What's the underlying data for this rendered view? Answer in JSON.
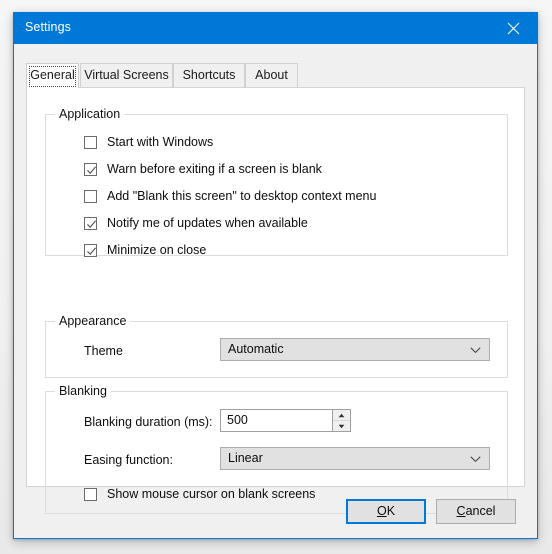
{
  "window": {
    "title": "Settings",
    "close_icon": "close-icon"
  },
  "tabs": [
    {
      "label": "General",
      "selected": true
    },
    {
      "label": "Virtual Screens",
      "selected": false
    },
    {
      "label": "Shortcuts",
      "selected": false
    },
    {
      "label": "About",
      "selected": false
    }
  ],
  "groups": {
    "application": {
      "label": "Application",
      "checkboxes": [
        {
          "label": "Start with Windows",
          "checked": false
        },
        {
          "label": "Warn before exiting if a screen is blank",
          "checked": true
        },
        {
          "label": "Add \"Blank this screen\" to desktop context menu",
          "checked": false
        },
        {
          "label": "Notify me of updates when available",
          "checked": true
        },
        {
          "label": "Minimize on close",
          "checked": true
        }
      ]
    },
    "appearance": {
      "label": "Appearance",
      "theme_label": "Theme",
      "theme_value": "Automatic"
    },
    "blanking": {
      "label": "Blanking",
      "duration_label": "Blanking duration (ms):",
      "duration_value": "500",
      "easing_label": "Easing function:",
      "easing_value": "Linear",
      "cursor_checkbox": {
        "label": "Show mouse cursor on blank screens",
        "checked": false
      }
    }
  },
  "buttons": {
    "ok": {
      "prefix": "",
      "accel": "O",
      "suffix": "K"
    },
    "cancel": {
      "prefix": "",
      "accel": "C",
      "suffix": "ancel"
    }
  },
  "colors": {
    "accent": "#0078d7",
    "titlebar": "#0078d7",
    "dialog_face": "#f0f0f0",
    "panel": "#ffffff",
    "control_face": "#e1e1e1"
  }
}
